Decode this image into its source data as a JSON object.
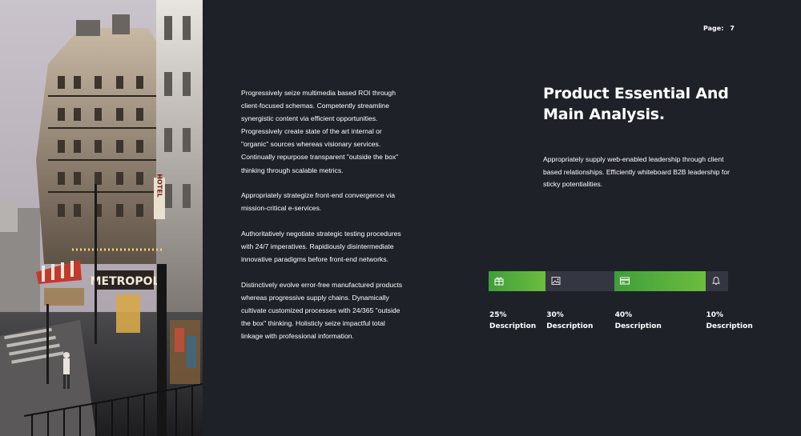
{
  "header": {
    "page_label": "Page:",
    "page_number": "7"
  },
  "body_paragraphs": [
    "Progressively seize multimedia based ROI through client-focused schemas. Competently streamline synergistic content via efficient opportunities. Progressively create state of the art internal or \"organic\" sources whereas visionary services. Continually repurpose transparent \"outside the box\" thinking through scalable metrics.",
    "Appropriately strategize front-end convergence via mission-critical e-services.",
    "Authoritatively negotiate strategic testing procedures with 24/7 imperatives. Rapidiously disintermediate innovative paradigms before front-end networks.",
    "Distinctively evolve error-free manufactured products whereas progressive supply chains. Dynamically cultivate customized processes with 24/365 \"outside the box\" thinking. Holisticly seize impactful total linkage with professional information."
  ],
  "heading": {
    "line1": "Product Essential And",
    "line2": "Main Analysis."
  },
  "intro": "Appropriately supply web-enabled leadership through client based relationships. Efficiently whiteboard B2B leadership for sticky potentialities.",
  "photo_sign_text": {
    "hotel": "HOTEL",
    "metropol": "METROPOL"
  },
  "stats": [
    {
      "percent": "25%",
      "value": 25,
      "label": "Description",
      "icon": "gift-icon",
      "style": "green"
    },
    {
      "percent": "30%",
      "value": 30,
      "label": "Description",
      "icon": "image-icon",
      "style": "dark"
    },
    {
      "percent": "40%",
      "value": 40,
      "label": "Description",
      "icon": "card-icon",
      "style": "green"
    },
    {
      "percent": "10%",
      "value": 10,
      "label": "Description",
      "icon": "bell-icon",
      "style": "dark"
    }
  ],
  "colors": {
    "background": "#1f2129",
    "accent_green": "#5fb33d",
    "bar_dark": "#343741",
    "text": "#ffffff"
  }
}
